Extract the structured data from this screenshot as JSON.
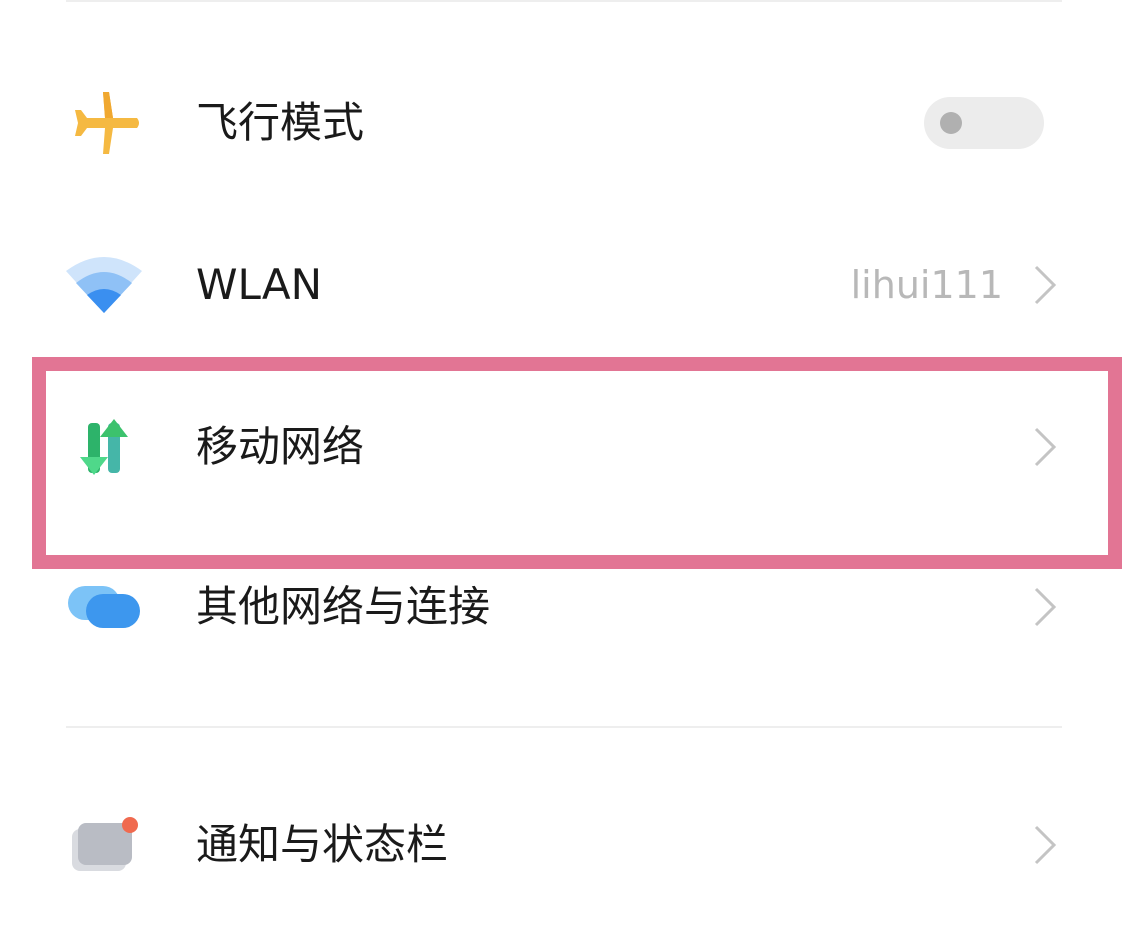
{
  "settings": {
    "items": [
      {
        "label": "飞行模式",
        "icon": "airplane-icon",
        "control": "toggle",
        "toggle_on": false
      },
      {
        "label": "WLAN",
        "icon": "wifi-icon",
        "value": "lihui111",
        "control": "chevron"
      },
      {
        "label": "移动网络",
        "icon": "mobile-data-icon",
        "control": "chevron",
        "highlighted": true
      },
      {
        "label": "其他网络与连接",
        "icon": "other-connections-icon",
        "control": "chevron"
      },
      {
        "label": "通知与状态栏",
        "icon": "notification-icon",
        "control": "chevron"
      }
    ]
  },
  "colors": {
    "highlight_border": "#e27594",
    "airplane": "#f5b942",
    "wifi": "#3a8ff0",
    "mobile_data_green": "#3cc26d",
    "other_connections": "#4aa3f2",
    "notification_badge": "#f06a4f"
  }
}
